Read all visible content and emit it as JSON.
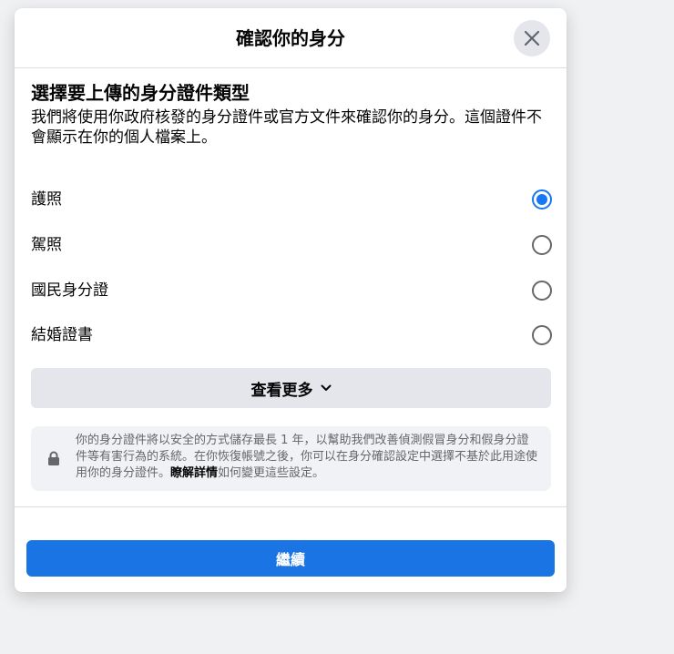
{
  "dialog": {
    "title": "確認你的身分",
    "close_icon": "close-icon"
  },
  "section": {
    "title": "選擇要上傳的身分證件類型",
    "description": "我們將使用你政府核發的身分證件或官方文件來確認你的身分。這個證件不會顯示在你的個人檔案上。"
  },
  "options": [
    {
      "label": "護照",
      "selected": true
    },
    {
      "label": "駕照",
      "selected": false
    },
    {
      "label": "國民身分證",
      "selected": false
    },
    {
      "label": "結婚證書",
      "selected": false
    }
  ],
  "see_more": {
    "label": "查看更多",
    "icon": "chevron-down-icon"
  },
  "notice": {
    "icon": "lock-icon",
    "text_before": "你的身分證件將以安全的方式儲存最長 1 年，以幫助我們改善偵測假冒身分和假身分證件等有害行為的系統。在你恢復帳號之後，你可以在身分確認設定中選擇不基於此用途使用你的身分證件。",
    "link": "瞭解詳情",
    "text_after": "如何變更這些設定。"
  },
  "footer": {
    "continue_label": "繼續"
  },
  "colors": {
    "primary": "#1b74e4",
    "radio_selected": "#1877f2",
    "secondary_button": "#e4e6eb",
    "notice_bg": "#f0f2f5",
    "muted_text": "#65676b"
  }
}
